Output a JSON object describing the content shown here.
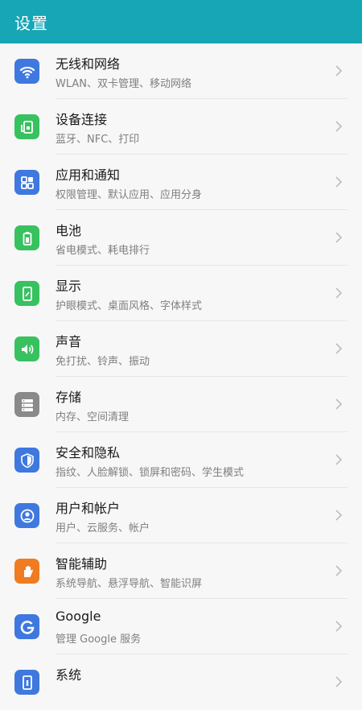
{
  "header": {
    "title": "设置"
  },
  "colors": {
    "header_bg": "#16a6b6",
    "blue": "#3f78de",
    "green": "#38c15f",
    "gray": "#8a8a8a",
    "orange": "#f07b20"
  },
  "items": [
    {
      "label": "无线和网络",
      "sub": "WLAN、双卡管理、移动网络",
      "icon": "wifi-icon",
      "color": "blue"
    },
    {
      "label": "设备连接",
      "sub": "蓝牙、NFC、打印",
      "icon": "device-connection-icon",
      "color": "green"
    },
    {
      "label": "应用和通知",
      "sub": "权限管理、默认应用、应用分身",
      "icon": "apps-icon",
      "color": "blue"
    },
    {
      "label": "电池",
      "sub": "省电模式、耗电排行",
      "icon": "battery-icon",
      "color": "green"
    },
    {
      "label": "显示",
      "sub": "护眼模式、桌面风格、字体样式",
      "icon": "display-icon",
      "color": "green"
    },
    {
      "label": "声音",
      "sub": "免打扰、铃声、振动",
      "icon": "speaker-icon",
      "color": "green"
    },
    {
      "label": "存储",
      "sub": "内存、空间清理",
      "icon": "storage-icon",
      "color": "gray"
    },
    {
      "label": "安全和隐私",
      "sub": "指纹、人脸解锁、锁屏和密码、学生模式",
      "icon": "shield-icon",
      "color": "blue"
    },
    {
      "label": "用户和帐户",
      "sub": "用户、云服务、帐户",
      "icon": "user-icon",
      "color": "blue"
    },
    {
      "label": "智能辅助",
      "sub": "系统导航、悬浮导航、智能识屏",
      "icon": "hand-icon",
      "color": "orange"
    },
    {
      "label": "Google",
      "sub": "管理 Google 服务",
      "icon": "google-icon",
      "color": "blue"
    },
    {
      "label": "系统",
      "sub": "",
      "icon": "system-icon",
      "color": "blue"
    }
  ]
}
